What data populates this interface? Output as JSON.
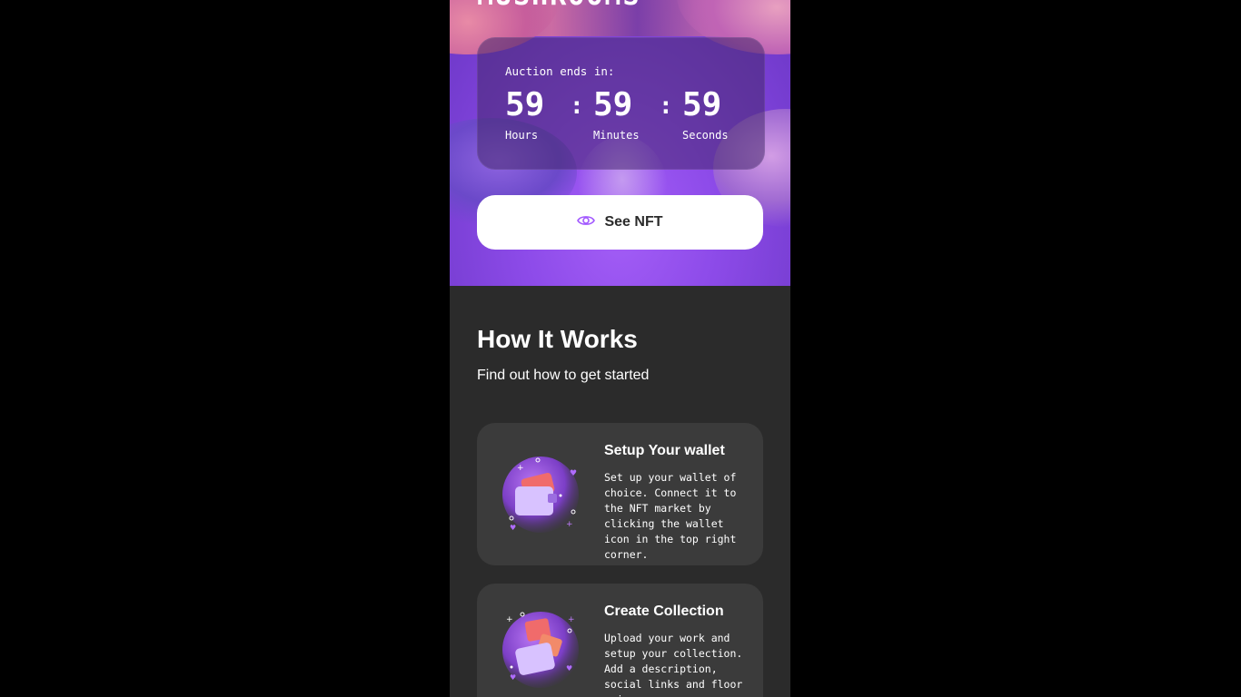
{
  "hero": {
    "title": "MUSHROOMS"
  },
  "auction": {
    "label": "Auction ends in:",
    "hours": "59",
    "hours_label": "Hours",
    "minutes": "59",
    "minutes_label": "Minutes",
    "seconds": "59",
    "seconds_label": "Seconds",
    "separator": ":"
  },
  "see_nft": {
    "label": "See NFT",
    "icon": "eye-icon",
    "icon_color": "#a259ff"
  },
  "how_it_works": {
    "title": "How It Works",
    "subtitle": "Find out how to get started",
    "steps": [
      {
        "title": "Setup Your wallet",
        "text": "Set up your wallet of choice. Connect it to the NFT market by clicking the wallet icon in the top right corner.",
        "icon": "wallet-illustration"
      },
      {
        "title": "Create Collection",
        "text": "Upload your work and setup your collection. Add a description, social links and floor price.",
        "icon": "collection-illustration"
      }
    ]
  },
  "colors": {
    "accent": "#a259ff",
    "background": "#2b2b2b",
    "card": "#3b3b3b"
  }
}
